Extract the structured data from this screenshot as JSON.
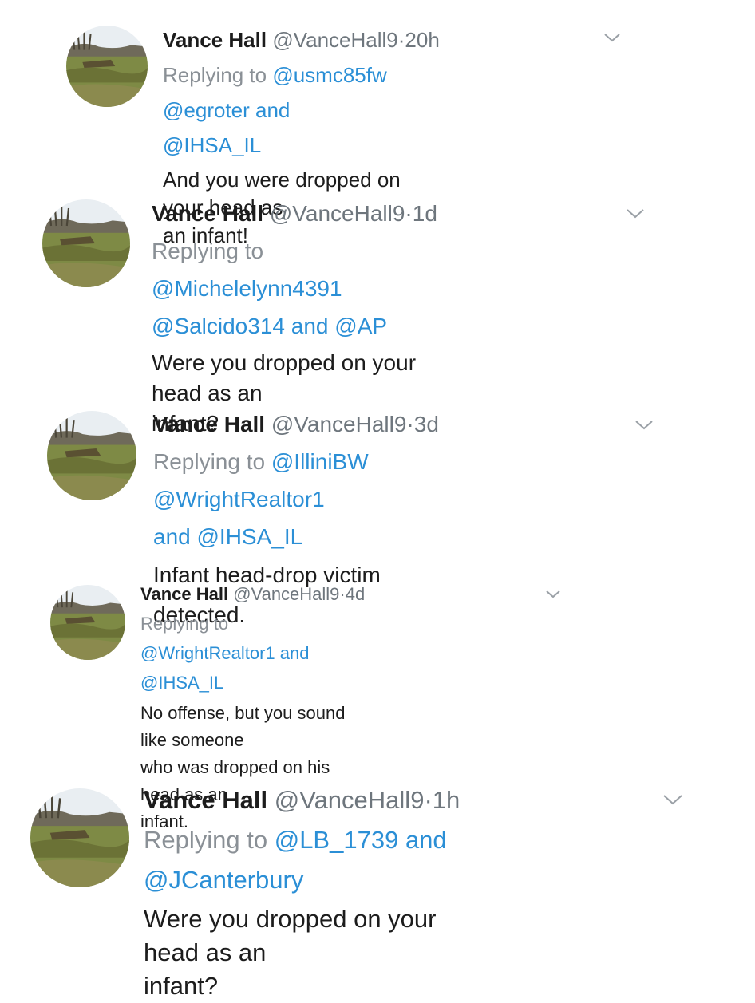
{
  "tweets": [
    {
      "name": "Vance Hall",
      "handle": "@VanceHall9",
      "time": "20h",
      "replying_to_label": "Replying to",
      "mentions": [
        "@usmc85fw",
        "@egroter",
        "and",
        "@IHSA_IL"
      ],
      "text_lines": [
        "And you were dropped on your head as",
        "an infant!"
      ]
    },
    {
      "name": "Vance Hall",
      "handle": "@VanceHall9",
      "time": "1d",
      "replying_to_label": "Replying to",
      "mentions": [
        "@Michelelynn4391",
        "@Salcido314",
        "and",
        "@AP"
      ],
      "text_lines": [
        "Were you dropped on your head as an",
        "infant?"
      ]
    },
    {
      "name": "Vance Hall",
      "handle": "@VanceHall9",
      "time": "3d",
      "replying_to_label": "Replying to",
      "mentions": [
        "@IlliniBW",
        "@WrightRealtor1",
        "and",
        "@IHSA_IL"
      ],
      "text_lines": [
        "Infant head-drop victim detected."
      ]
    },
    {
      "name": "Vance Hall",
      "handle": "@VanceHall9",
      "time": "4d",
      "replying_to_label": "Replying to",
      "mentions": [
        "@WrightRealtor1",
        "and",
        "@IHSA_IL"
      ],
      "text_lines": [
        "No offense, but you sound like someone",
        "who was dropped on his head as an",
        "infant."
      ]
    },
    {
      "name": "Vance Hall",
      "handle": "@VanceHall9",
      "time": "1h",
      "replying_to_label": "Replying to",
      "mentions": [
        "@LB_1739",
        "and",
        "@JCanterbury"
      ],
      "text_lines": [
        "Were you dropped on your head as an",
        "infant?"
      ]
    }
  ],
  "separator": "·",
  "icons": {
    "menu": "chevron-down-icon",
    "avatar": "profile-photo-field-icon"
  },
  "colors": {
    "mention": "#2b8fd6",
    "secondary": "#6e767d",
    "text": "#1c1c1c"
  }
}
